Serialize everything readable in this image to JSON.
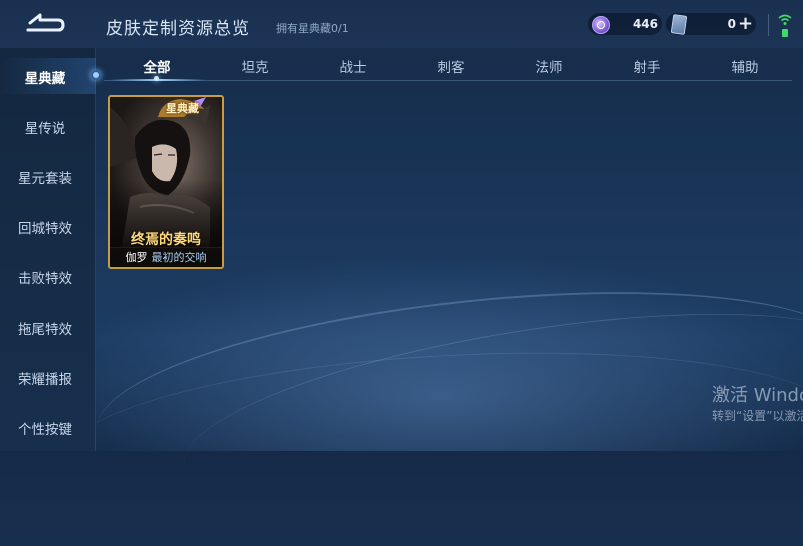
{
  "header": {
    "title": "皮肤定制资源总览",
    "owned_text": "拥有星典藏0/1",
    "currency1_value": "446",
    "currency2_value": "0",
    "plus_label": "+",
    "icons": {
      "back": "back-arrow-icon",
      "coin": "star-coin-icon",
      "ticket": "ticket-icon",
      "wifi": "wifi-icon",
      "battery": "battery-icon"
    }
  },
  "sidebar": {
    "items": [
      {
        "label": "星典藏",
        "active": true
      },
      {
        "label": "星传说"
      },
      {
        "label": "星元套装"
      },
      {
        "label": "回城特效"
      },
      {
        "label": "击败特效"
      },
      {
        "label": "拖尾特效"
      },
      {
        "label": "荣耀播报"
      },
      {
        "label": "个性按键"
      }
    ]
  },
  "tabs": [
    {
      "label": "全部",
      "active": true
    },
    {
      "label": "坦克"
    },
    {
      "label": "战士"
    },
    {
      "label": "刺客"
    },
    {
      "label": "法师"
    },
    {
      "label": "射手"
    },
    {
      "label": "辅助"
    }
  ],
  "cards": [
    {
      "badge": "星典藏",
      "skin_name": "终焉的奏鸣",
      "hero": "伽罗",
      "subtitle": "最初的交响"
    }
  ],
  "watermark": {
    "line1": "激活 Windows",
    "line2": "转到“设置”以激活 Windows。"
  },
  "colors": {
    "accent": "#9fd4ff",
    "gold": "#c89b45",
    "skin_name": "#ffd879"
  }
}
